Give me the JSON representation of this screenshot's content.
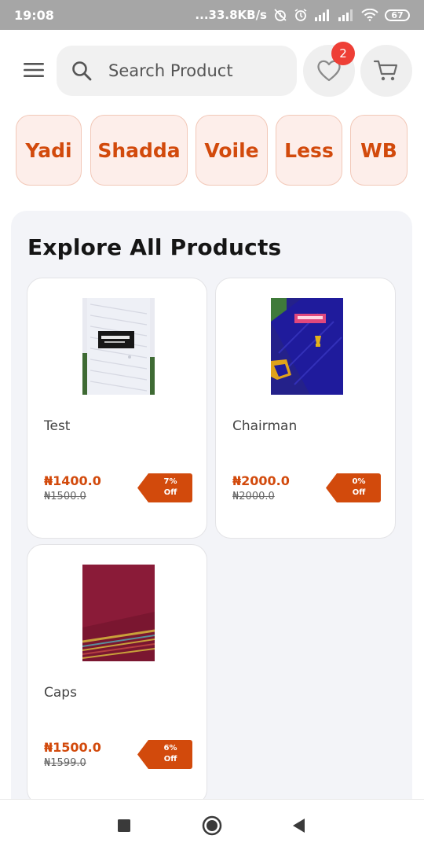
{
  "status_bar": {
    "time": "19:08",
    "network_speed": "...33.8KB/s",
    "battery": "67",
    "icons": [
      "alarm-off-icon",
      "alarm-icon",
      "signal-icon",
      "signal-icon",
      "wifi-icon",
      "battery-icon"
    ]
  },
  "header": {
    "menu_icon": "menu-icon",
    "search_placeholder": "Search Product",
    "search_value": "",
    "wishlist_count": "2",
    "wishlist_icon": "heart-icon",
    "cart_icon": "cart-icon"
  },
  "categories": [
    {
      "label": "Yadi"
    },
    {
      "label": "Shadda"
    },
    {
      "label": "Voile"
    },
    {
      "label": "Less"
    },
    {
      "label": "WB"
    }
  ],
  "explore": {
    "title": "Explore All Products",
    "products": [
      {
        "name": "Test",
        "price": "₦1400.0",
        "old_price": "₦1500.0",
        "discount": "7%",
        "discount_suffix": "Off"
      },
      {
        "name": "Chairman",
        "price": "₦2000.0",
        "old_price": "₦2000.0",
        "discount": "0%",
        "discount_suffix": "Off"
      },
      {
        "name": "Caps",
        "price": "₦1500.0",
        "old_price": "₦1599.0",
        "discount": "6%",
        "discount_suffix": "Off"
      }
    ]
  },
  "navbar": {
    "icons": [
      "recents-square-icon",
      "home-circle-icon",
      "back-triangle-icon"
    ]
  },
  "colors": {
    "accent": "#d24a0c",
    "chip_bg": "#fdeeea",
    "badge": "#ee3f36",
    "panel_bg": "#f3f4f8",
    "status_bar": "#a6a6a6"
  }
}
